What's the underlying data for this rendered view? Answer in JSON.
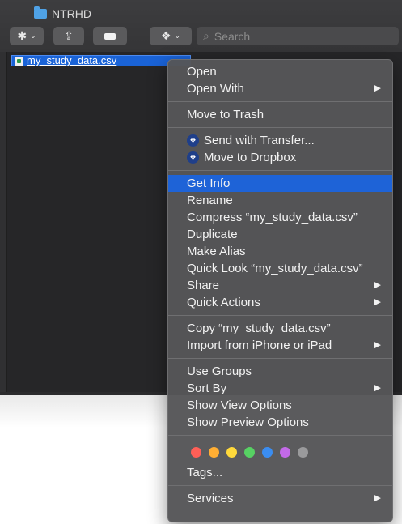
{
  "window": {
    "folder_title": "NTRHD",
    "search_placeholder": "Search",
    "selected_file": "my_study_data.csv"
  },
  "menu": {
    "group1": [
      "Open",
      "Open With"
    ],
    "move_to_trash": "Move to Trash",
    "send_with_transfer": "Send with Transfer...",
    "move_to_dropbox": "Move to Dropbox",
    "get_info": "Get Info",
    "rename": "Rename",
    "compress": "Compress “my_study_data.csv”",
    "duplicate": "Duplicate",
    "make_alias": "Make Alias",
    "quick_look": "Quick Look “my_study_data.csv”",
    "share": "Share",
    "quick_actions": "Quick Actions",
    "copy": "Copy “my_study_data.csv”",
    "import_iphone": "Import from iPhone or iPad",
    "use_groups": "Use Groups",
    "sort_by": "Sort By",
    "show_view_options": "Show View Options",
    "show_preview_options": "Show Preview Options",
    "tags": "Tags...",
    "services": "Services",
    "submenu_arrow": "▶",
    "tag_colors": [
      "#ff5f57",
      "#ffae33",
      "#ffd93b",
      "#57d163",
      "#3b8df0",
      "#c36ae8",
      "#9a9a9c"
    ]
  }
}
